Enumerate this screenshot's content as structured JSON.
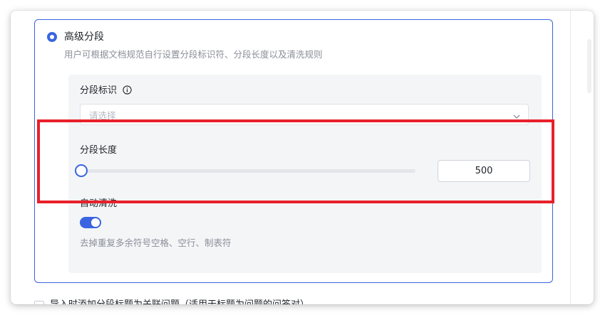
{
  "option": {
    "title": "高级分段",
    "description": "用户可根据文档规范自行设置分段标识符、分段长度以及清洗规则",
    "selected": true
  },
  "segment_identifier": {
    "label": "分段标识",
    "placeholder": "请选择"
  },
  "segment_length": {
    "label": "分段长度",
    "value": "500",
    "slider_fraction": 0.0
  },
  "auto_clean": {
    "label": "自动清洗",
    "enabled": true,
    "description": "去掉重复多余符号空格、空行、制表符"
  },
  "bottom_option": {
    "label": "导入时添加分段标题为关联问题（适用于标题为问题的问答对）"
  },
  "colors": {
    "accent": "#3a64e0",
    "highlight": "#e8202a"
  },
  "icons": {
    "info": "info-icon",
    "dropdown": "chevron-down-icon"
  }
}
